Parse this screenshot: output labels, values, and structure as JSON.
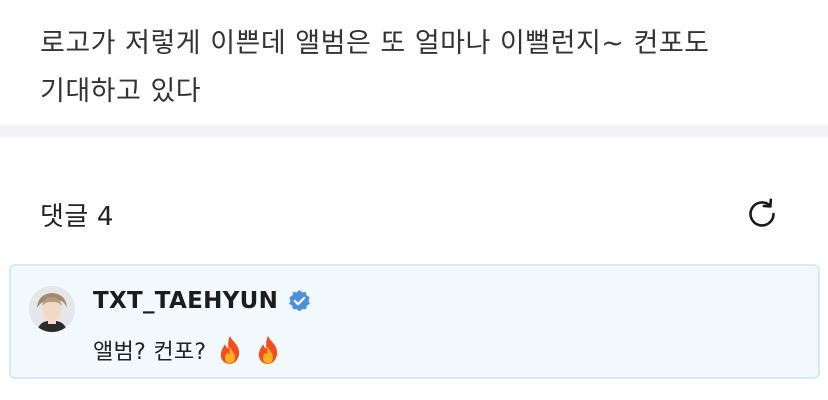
{
  "post": {
    "lines": [
      "로고가 저렇게 이쁜데 앨범은 또 얼마나 이뻘런지~ 컨포도",
      "기대하고 있다"
    ]
  },
  "comments": {
    "title": "댓글",
    "count": "4",
    "refresh_icon": "refresh-icon"
  },
  "comment_list": [
    {
      "author": "TXT_TAEHYUN",
      "verified": true,
      "text": "앨범? 컨포?",
      "emojis": [
        "fire-icon",
        "fire-icon"
      ]
    }
  ],
  "colors": {
    "verified_badge": "#4a90e2",
    "comment_highlight_bg": "#f1f9fc",
    "comment_highlight_border": "#d3ecf3",
    "divider": "#f4f4f7"
  }
}
